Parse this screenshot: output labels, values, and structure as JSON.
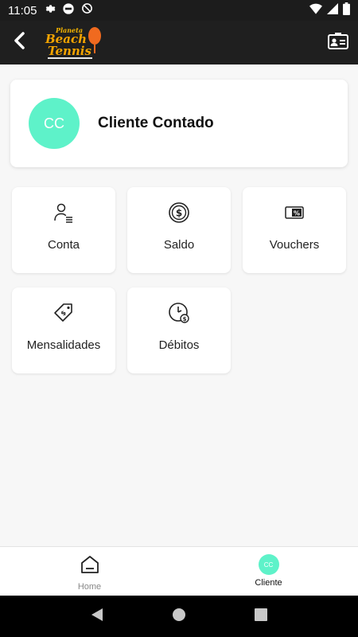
{
  "status_bar": {
    "time": "11:05",
    "icons_left": [
      "settings-icon",
      "app-notification-icon",
      "do-not-disturb-icon"
    ],
    "icons_right": [
      "wifi-icon",
      "signal-icon",
      "battery-icon"
    ]
  },
  "app_bar": {
    "logo_alt_text": "Planeta Beach Tennis",
    "back_icon": "chevron-left-icon",
    "profile_icon": "contact-card-icon"
  },
  "client_card": {
    "initials": "CC",
    "name": "Cliente Contado",
    "avatar_color": "#5ef2c9"
  },
  "tiles": [
    {
      "label": "Conta",
      "icon": "user-list-icon"
    },
    {
      "label": "Saldo",
      "icon": "dollar-coin-icon"
    },
    {
      "label": "Vouchers",
      "icon": "voucher-percent-icon"
    },
    {
      "label": "Mensalidades",
      "icon": "price-tag-icon"
    },
    {
      "label": "Débitos",
      "icon": "clock-dollar-icon"
    }
  ],
  "bottom_nav": {
    "items": [
      {
        "label": "Home",
        "icon": "home-icon",
        "active": false
      },
      {
        "label": "Cliente",
        "avatar_initials": "CC",
        "active": true
      }
    ]
  },
  "colors": {
    "accent": "#5ef2c9",
    "header_bg": "#1f1f1f",
    "page_bg": "#f7f7f7"
  }
}
